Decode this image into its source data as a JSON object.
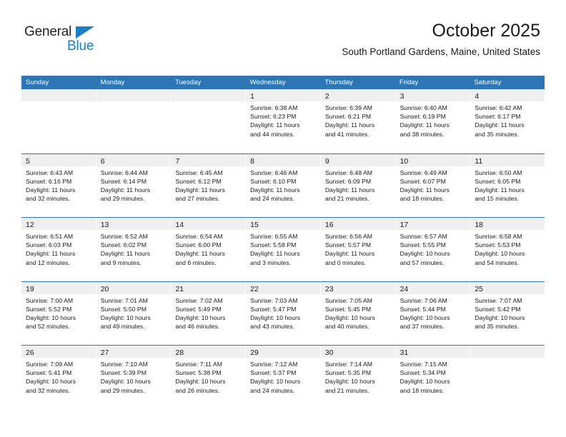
{
  "brand": {
    "name_top": "General",
    "name_bottom": "Blue",
    "accent_color": "#1b7fc4"
  },
  "header": {
    "title": "October 2025",
    "subtitle": "South Portland Gardens, Maine, United States"
  },
  "theme": {
    "header_blue": "#2e75b6",
    "day_band_gray": "#efefef",
    "text": "#1a1a1a"
  },
  "weekdays": [
    "Sunday",
    "Monday",
    "Tuesday",
    "Wednesday",
    "Thursday",
    "Friday",
    "Saturday"
  ],
  "weeks": [
    [
      {
        "day": "",
        "lines": []
      },
      {
        "day": "",
        "lines": []
      },
      {
        "day": "",
        "lines": []
      },
      {
        "day": "1",
        "lines": [
          "Sunrise: 6:38 AM",
          "Sunset: 6:23 PM",
          "Daylight: 11 hours",
          "and 44 minutes."
        ]
      },
      {
        "day": "2",
        "lines": [
          "Sunrise: 6:39 AM",
          "Sunset: 6:21 PM",
          "Daylight: 11 hours",
          "and 41 minutes."
        ]
      },
      {
        "day": "3",
        "lines": [
          "Sunrise: 6:40 AM",
          "Sunset: 6:19 PM",
          "Daylight: 11 hours",
          "and 38 minutes."
        ]
      },
      {
        "day": "4",
        "lines": [
          "Sunrise: 6:42 AM",
          "Sunset: 6:17 PM",
          "Daylight: 11 hours",
          "and 35 minutes."
        ]
      }
    ],
    [
      {
        "day": "5",
        "lines": [
          "Sunrise: 6:43 AM",
          "Sunset: 6:16 PM",
          "Daylight: 11 hours",
          "and 32 minutes."
        ]
      },
      {
        "day": "6",
        "lines": [
          "Sunrise: 6:44 AM",
          "Sunset: 6:14 PM",
          "Daylight: 11 hours",
          "and 29 minutes."
        ]
      },
      {
        "day": "7",
        "lines": [
          "Sunrise: 6:45 AM",
          "Sunset: 6:12 PM",
          "Daylight: 11 hours",
          "and 27 minutes."
        ]
      },
      {
        "day": "8",
        "lines": [
          "Sunrise: 6:46 AM",
          "Sunset: 6:10 PM",
          "Daylight: 11 hours",
          "and 24 minutes."
        ]
      },
      {
        "day": "9",
        "lines": [
          "Sunrise: 6:48 AM",
          "Sunset: 6:09 PM",
          "Daylight: 11 hours",
          "and 21 minutes."
        ]
      },
      {
        "day": "10",
        "lines": [
          "Sunrise: 6:49 AM",
          "Sunset: 6:07 PM",
          "Daylight: 11 hours",
          "and 18 minutes."
        ]
      },
      {
        "day": "11",
        "lines": [
          "Sunrise: 6:50 AM",
          "Sunset: 6:05 PM",
          "Daylight: 11 hours",
          "and 15 minutes."
        ]
      }
    ],
    [
      {
        "day": "12",
        "lines": [
          "Sunrise: 6:51 AM",
          "Sunset: 6:03 PM",
          "Daylight: 11 hours",
          "and 12 minutes."
        ]
      },
      {
        "day": "13",
        "lines": [
          "Sunrise: 6:52 AM",
          "Sunset: 6:02 PM",
          "Daylight: 11 hours",
          "and 9 minutes."
        ]
      },
      {
        "day": "14",
        "lines": [
          "Sunrise: 6:54 AM",
          "Sunset: 6:00 PM",
          "Daylight: 11 hours",
          "and 6 minutes."
        ]
      },
      {
        "day": "15",
        "lines": [
          "Sunrise: 6:55 AM",
          "Sunset: 5:58 PM",
          "Daylight: 11 hours",
          "and 3 minutes."
        ]
      },
      {
        "day": "16",
        "lines": [
          "Sunrise: 6:56 AM",
          "Sunset: 5:57 PM",
          "Daylight: 11 hours",
          "and 0 minutes."
        ]
      },
      {
        "day": "17",
        "lines": [
          "Sunrise: 6:57 AM",
          "Sunset: 5:55 PM",
          "Daylight: 10 hours",
          "and 57 minutes."
        ]
      },
      {
        "day": "18",
        "lines": [
          "Sunrise: 6:58 AM",
          "Sunset: 5:53 PM",
          "Daylight: 10 hours",
          "and 54 minutes."
        ]
      }
    ],
    [
      {
        "day": "19",
        "lines": [
          "Sunrise: 7:00 AM",
          "Sunset: 5:52 PM",
          "Daylight: 10 hours",
          "and 52 minutes."
        ]
      },
      {
        "day": "20",
        "lines": [
          "Sunrise: 7:01 AM",
          "Sunset: 5:50 PM",
          "Daylight: 10 hours",
          "and 49 minutes."
        ]
      },
      {
        "day": "21",
        "lines": [
          "Sunrise: 7:02 AM",
          "Sunset: 5:49 PM",
          "Daylight: 10 hours",
          "and 46 minutes."
        ]
      },
      {
        "day": "22",
        "lines": [
          "Sunrise: 7:03 AM",
          "Sunset: 5:47 PM",
          "Daylight: 10 hours",
          "and 43 minutes."
        ]
      },
      {
        "day": "23",
        "lines": [
          "Sunrise: 7:05 AM",
          "Sunset: 5:45 PM",
          "Daylight: 10 hours",
          "and 40 minutes."
        ]
      },
      {
        "day": "24",
        "lines": [
          "Sunrise: 7:06 AM",
          "Sunset: 5:44 PM",
          "Daylight: 10 hours",
          "and 37 minutes."
        ]
      },
      {
        "day": "25",
        "lines": [
          "Sunrise: 7:07 AM",
          "Sunset: 5:42 PM",
          "Daylight: 10 hours",
          "and 35 minutes."
        ]
      }
    ],
    [
      {
        "day": "26",
        "lines": [
          "Sunrise: 7:09 AM",
          "Sunset: 5:41 PM",
          "Daylight: 10 hours",
          "and 32 minutes."
        ]
      },
      {
        "day": "27",
        "lines": [
          "Sunrise: 7:10 AM",
          "Sunset: 5:39 PM",
          "Daylight: 10 hours",
          "and 29 minutes."
        ]
      },
      {
        "day": "28",
        "lines": [
          "Sunrise: 7:11 AM",
          "Sunset: 5:38 PM",
          "Daylight: 10 hours",
          "and 26 minutes."
        ]
      },
      {
        "day": "29",
        "lines": [
          "Sunrise: 7:12 AM",
          "Sunset: 5:37 PM",
          "Daylight: 10 hours",
          "and 24 minutes."
        ]
      },
      {
        "day": "30",
        "lines": [
          "Sunrise: 7:14 AM",
          "Sunset: 5:35 PM",
          "Daylight: 10 hours",
          "and 21 minutes."
        ]
      },
      {
        "day": "31",
        "lines": [
          "Sunrise: 7:15 AM",
          "Sunset: 5:34 PM",
          "Daylight: 10 hours",
          "and 18 minutes."
        ]
      },
      {
        "day": "",
        "lines": []
      }
    ]
  ]
}
